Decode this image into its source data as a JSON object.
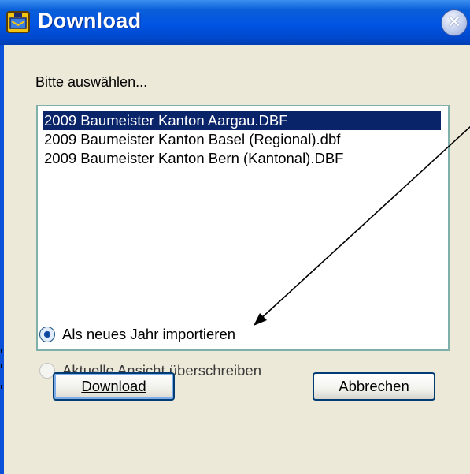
{
  "window": {
    "title": "Download",
    "colors": {
      "titlebar": "#0054e3",
      "face": "#ece9d8",
      "selection": "#0a246a"
    },
    "icons": {
      "app": "app-icon",
      "close": "close-icon"
    }
  },
  "dialog": {
    "prompt": "Bitte auswählen...",
    "files": [
      "2009 Baumeister Kanton Aargau.DBF",
      "2009 Baumeister Kanton Basel (Regional).dbf",
      "2009 Baumeister Kanton Bern (Kantonal).DBF"
    ],
    "selected_index": 0,
    "options": [
      {
        "label": "Als neues Jahr importieren",
        "checked": true
      },
      {
        "label": "Aktuelle Ansicht überschreiben",
        "checked": false
      }
    ],
    "buttons": {
      "download": "Download",
      "cancel": "Abbrechen"
    }
  }
}
